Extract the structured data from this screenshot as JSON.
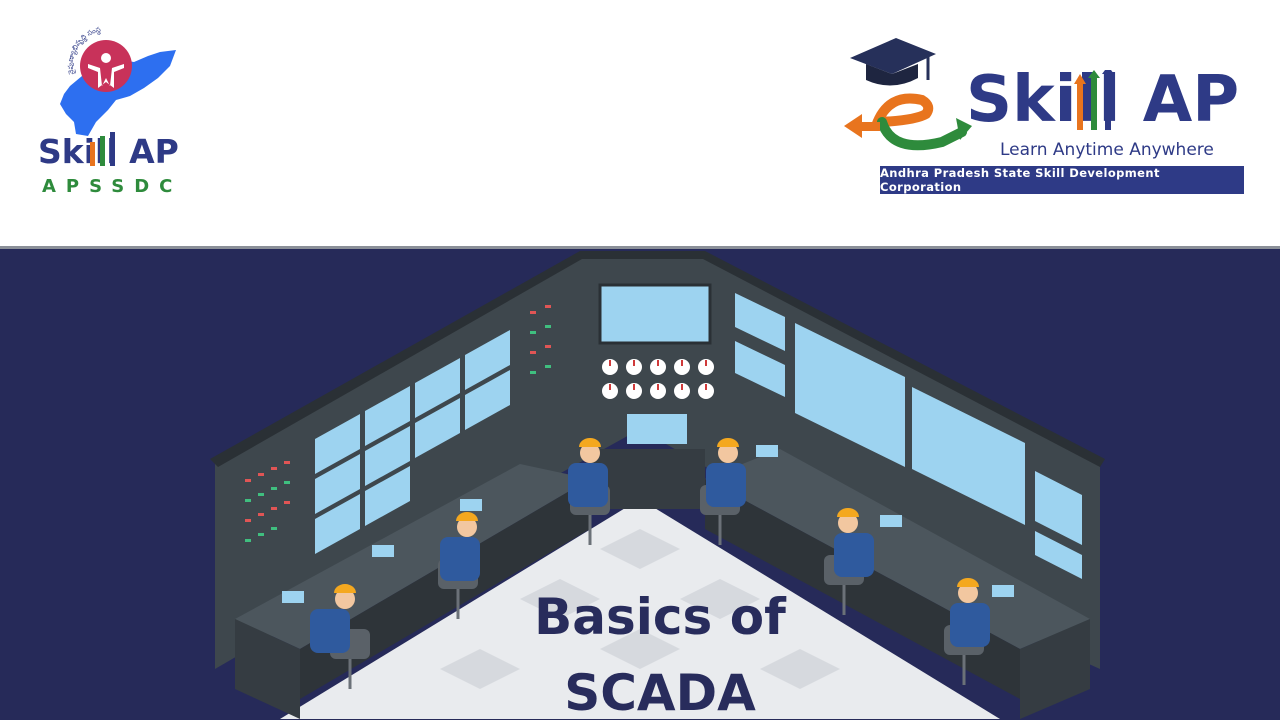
{
  "left_logo": {
    "circular_text": "నైపుణ్యాభివృద్ధి సంస్థ",
    "brand": "Skill AP",
    "sub": "APSSDC"
  },
  "right_logo": {
    "brand": "Skill AP",
    "tagline": "Learn Anytime Anywhere",
    "corporation": "Andhra Pradesh State Skill Development Corporation"
  },
  "hero": {
    "title_line1": "Basics of",
    "title_line2": "SCADA"
  },
  "colors": {
    "navy": "#262a59",
    "brand_blue": "#2e3a86",
    "green": "#2e8b3c",
    "orange": "#e8741e"
  }
}
